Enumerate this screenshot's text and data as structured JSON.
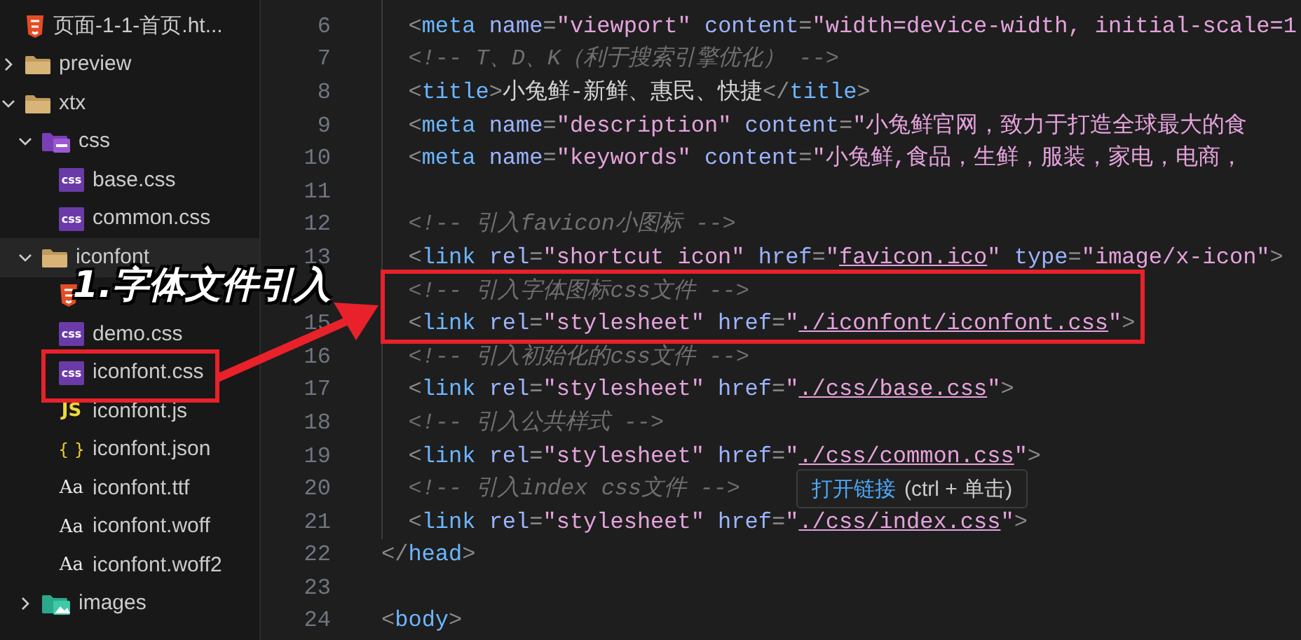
{
  "explorer": {
    "items": [
      {
        "name": "页面-1-1-首页.ht...",
        "kind": "html",
        "selected": false
      },
      {
        "name": "preview",
        "kind": "folder",
        "expanded": false,
        "selected": false
      },
      {
        "name": "xtx",
        "kind": "folder",
        "expanded": true,
        "selected": false,
        "children": [
          {
            "name": "css",
            "kind": "css-folder",
            "expanded": true,
            "selected": false,
            "children": [
              {
                "name": "base.css",
                "kind": "css",
                "icon_glyph": "css",
                "selected": false
              },
              {
                "name": "common.css",
                "kind": "css",
                "icon_glyph": "css",
                "selected": false
              }
            ]
          },
          {
            "name": "iconfont",
            "kind": "folder",
            "expanded": true,
            "selected": true,
            "children": [
              {
                "kind": "html",
                "selected": false
              },
              {
                "name": "demo.css",
                "kind": "css",
                "icon_glyph": "css",
                "selected": false
              },
              {
                "name": "iconfont.css",
                "kind": "css",
                "icon_glyph": "css",
                "selected": false
              },
              {
                "name": "iconfont.js",
                "kind": "js",
                "icon_glyph": "JS",
                "selected": false
              },
              {
                "name": "iconfont.json",
                "kind": "json",
                "icon_glyph": "{ }",
                "selected": false
              },
              {
                "name": "iconfont.ttf",
                "kind": "font",
                "icon_glyph": "Aa",
                "selected": false
              },
              {
                "name": "iconfont.woff",
                "kind": "font",
                "icon_glyph": "Aa",
                "selected": false
              },
              {
                "name": "iconfont.woff2",
                "kind": "font",
                "icon_glyph": "Aa",
                "selected": false
              }
            ]
          },
          {
            "name": "images",
            "kind": "image-folder",
            "expanded": false,
            "selected": false
          }
        ]
      }
    ]
  },
  "editor": {
    "lines": [
      {
        "number": "6",
        "tokens": [
          {
            "kind": "p",
            "text": "  <"
          },
          {
            "kind": "tag",
            "text": "meta"
          },
          {
            "kind": "attr",
            "text": " name"
          },
          {
            "kind": "p",
            "text": "="
          },
          {
            "kind": "str",
            "text": "\"viewport\""
          },
          {
            "kind": "attr",
            "text": " content"
          },
          {
            "kind": "p",
            "text": "="
          },
          {
            "kind": "str",
            "text": "\"width=device-width, initial-scale=1"
          }
        ]
      },
      {
        "number": "7",
        "tokens": [
          {
            "kind": "cm",
            "text": "  <!-- T、D、K（利于搜索引擎优化） -->"
          }
        ]
      },
      {
        "number": "8",
        "tokens": [
          {
            "kind": "p",
            "text": "  <"
          },
          {
            "kind": "tag",
            "text": "title"
          },
          {
            "kind": "p",
            "text": ">"
          },
          {
            "kind": "tx",
            "text": "小兔鲜-新鲜、惠民、快捷"
          },
          {
            "kind": "p",
            "text": "</"
          },
          {
            "kind": "tag",
            "text": "title"
          },
          {
            "kind": "p",
            "text": ">"
          }
        ]
      },
      {
        "number": "9",
        "tokens": [
          {
            "kind": "p",
            "text": "  <"
          },
          {
            "kind": "tag",
            "text": "meta"
          },
          {
            "kind": "attr",
            "text": " name"
          },
          {
            "kind": "p",
            "text": "="
          },
          {
            "kind": "str",
            "text": "\"description\""
          },
          {
            "kind": "attr",
            "text": " content"
          },
          {
            "kind": "p",
            "text": "="
          },
          {
            "kind": "str",
            "text": "\"小兔鲜官网，致力于打造全球最大的食"
          }
        ]
      },
      {
        "number": "10",
        "tokens": [
          {
            "kind": "p",
            "text": "  <"
          },
          {
            "kind": "tag",
            "text": "meta"
          },
          {
            "kind": "attr",
            "text": " name"
          },
          {
            "kind": "p",
            "text": "="
          },
          {
            "kind": "str",
            "text": "\"keywords\""
          },
          {
            "kind": "attr",
            "text": " content"
          },
          {
            "kind": "p",
            "text": "="
          },
          {
            "kind": "str",
            "text": "\"小兔鲜,食品，生鲜，服装，家电，电商，"
          }
        ]
      },
      {
        "number": "11"
      },
      {
        "number": "12",
        "tokens": [
          {
            "kind": "cm",
            "text": "  <!-- 引入favicon小图标 -->"
          }
        ]
      },
      {
        "number": "13",
        "tokens": [
          {
            "kind": "p",
            "text": "  <"
          },
          {
            "kind": "tag",
            "text": "link"
          },
          {
            "kind": "attr",
            "text": " rel"
          },
          {
            "kind": "p",
            "text": "="
          },
          {
            "kind": "str",
            "text": "\"shortcut icon\""
          },
          {
            "kind": "attr",
            "text": " href"
          },
          {
            "kind": "p",
            "text": "="
          },
          {
            "kind": "str",
            "text": "\""
          },
          {
            "kind": "link",
            "text": "favicon.ico"
          },
          {
            "kind": "str",
            "text": "\""
          },
          {
            "kind": "attr",
            "text": " type"
          },
          {
            "kind": "p",
            "text": "="
          },
          {
            "kind": "str",
            "text": "\"image/x-icon\""
          },
          {
            "kind": "p",
            "text": ">"
          }
        ]
      },
      {
        "tokens": [
          {
            "kind": "cm",
            "text": "  <!-- 引入字体图标css文件 -->"
          }
        ]
      },
      {
        "number": "15",
        "tokens": [
          {
            "kind": "p",
            "text": "  <"
          },
          {
            "kind": "tag",
            "text": "link"
          },
          {
            "kind": "attr",
            "text": " rel"
          },
          {
            "kind": "p",
            "text": "="
          },
          {
            "kind": "str",
            "text": "\"stylesheet\""
          },
          {
            "kind": "attr",
            "text": " href"
          },
          {
            "kind": "p",
            "text": "="
          },
          {
            "kind": "str",
            "text": "\""
          },
          {
            "kind": "link",
            "text": "./iconfont/iconfont.css"
          },
          {
            "kind": "str",
            "text": "\""
          },
          {
            "kind": "p",
            "text": ">"
          }
        ]
      },
      {
        "number": "16",
        "tokens": [
          {
            "kind": "cm",
            "text": "  <!-- 引入初始化的css文件 -->"
          }
        ]
      },
      {
        "number": "17",
        "tokens": [
          {
            "kind": "p",
            "text": "  <"
          },
          {
            "kind": "tag",
            "text": "link"
          },
          {
            "kind": "attr",
            "text": " rel"
          },
          {
            "kind": "p",
            "text": "="
          },
          {
            "kind": "str",
            "text": "\"stylesheet\""
          },
          {
            "kind": "attr",
            "text": " href"
          },
          {
            "kind": "p",
            "text": "="
          },
          {
            "kind": "str",
            "text": "\""
          },
          {
            "kind": "link",
            "text": "./css/base.css"
          },
          {
            "kind": "str",
            "text": "\""
          },
          {
            "kind": "p",
            "text": ">"
          }
        ]
      },
      {
        "number": "18",
        "tokens": [
          {
            "kind": "cm",
            "text": "  <!-- 引入公共样式 -->"
          }
        ]
      },
      {
        "number": "19",
        "tokens": [
          {
            "kind": "p",
            "text": "  <"
          },
          {
            "kind": "tag",
            "text": "link"
          },
          {
            "kind": "attr",
            "text": " rel"
          },
          {
            "kind": "p",
            "text": "="
          },
          {
            "kind": "str",
            "text": "\"stylesheet\""
          },
          {
            "kind": "attr",
            "text": " href"
          },
          {
            "kind": "p",
            "text": "="
          },
          {
            "kind": "str",
            "text": "\""
          },
          {
            "kind": "link",
            "text": "./css/common.css"
          },
          {
            "kind": "str",
            "text": "\""
          },
          {
            "kind": "p",
            "text": ">"
          }
        ]
      },
      {
        "number": "20",
        "tokens": [
          {
            "kind": "cm",
            "text": "  <!-- 引入index css文件 -->"
          }
        ]
      },
      {
        "number": "21",
        "tokens": [
          {
            "kind": "p",
            "text": "  <"
          },
          {
            "kind": "tag",
            "text": "link"
          },
          {
            "kind": "attr",
            "text": " rel"
          },
          {
            "kind": "p",
            "text": "="
          },
          {
            "kind": "str",
            "text": "\"stylesheet\""
          },
          {
            "kind": "attr",
            "text": " href"
          },
          {
            "kind": "p",
            "text": "="
          },
          {
            "kind": "str",
            "text": "\""
          },
          {
            "kind": "link",
            "text": "./css/index.css"
          },
          {
            "kind": "str",
            "text": "\""
          },
          {
            "kind": "p",
            "text": ">"
          }
        ]
      },
      {
        "number": "22",
        "tokens": [
          {
            "kind": "p",
            "text": "</"
          },
          {
            "kind": "tag",
            "text": "head"
          },
          {
            "kind": "p",
            "text": ">"
          }
        ]
      },
      {
        "number": "23"
      },
      {
        "number": "24",
        "tokens": [
          {
            "kind": "p",
            "text": "<"
          },
          {
            "kind": "tag",
            "text": "body"
          },
          {
            "kind": "p",
            "text": ">"
          }
        ]
      }
    ]
  },
  "tooltip": {
    "link": "打开链接",
    "hint": "(ctrl + 单击)"
  },
  "annotation": {
    "label": "1.字体文件引入"
  }
}
